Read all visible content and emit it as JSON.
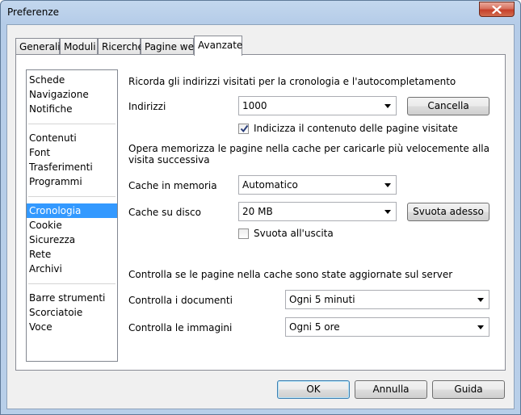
{
  "window": {
    "title": "Preferenze"
  },
  "tabs": [
    {
      "label": "Generali"
    },
    {
      "label": "Moduli"
    },
    {
      "label": "Ricerche"
    },
    {
      "label": "Pagine web"
    },
    {
      "label": "Avanzate",
      "active": true
    }
  ],
  "sidebar": {
    "groups": [
      [
        "Schede",
        "Navigazione",
        "Notifiche"
      ],
      [
        "Contenuti",
        "Font",
        "Trasferimenti",
        "Programmi"
      ],
      [
        "Cronologia",
        "Cookie",
        "Sicurezza",
        "Rete",
        "Archivi"
      ],
      [
        "Barre strumenti",
        "Scorciatoie",
        "Voce"
      ]
    ],
    "selected": "Cronologia"
  },
  "history": {
    "heading": "Ricorda gli indirizzi visitati per la cronologia e l'autocompletamento",
    "addresses_label": "Indirizzi",
    "addresses_value": "1000",
    "clear_button": "Cancella",
    "index_checkbox_label": "Indicizza il contenuto delle pagine visitate",
    "index_checked": true
  },
  "cache": {
    "heading_line1": "Opera memorizza le pagine nella cache per caricarle più velocemente alla",
    "heading_line2": "visita successiva",
    "memory_label": "Cache in memoria",
    "memory_value": "Automatico",
    "disk_label": "Cache su disco",
    "disk_value": "20 MB",
    "empty_now_button": "Svuota adesso",
    "empty_on_exit_label": "Svuota all'uscita",
    "empty_on_exit_checked": false
  },
  "check": {
    "heading": "Controlla se le pagine nella cache sono state aggiornate sul server",
    "documents_label": "Controlla i documenti",
    "documents_value": "Ogni 5 minuti",
    "images_label": "Controlla le immagini",
    "images_value": "Ogni 5 ore"
  },
  "footer": {
    "ok": "OK",
    "cancel": "Annulla",
    "help": "Guida"
  }
}
